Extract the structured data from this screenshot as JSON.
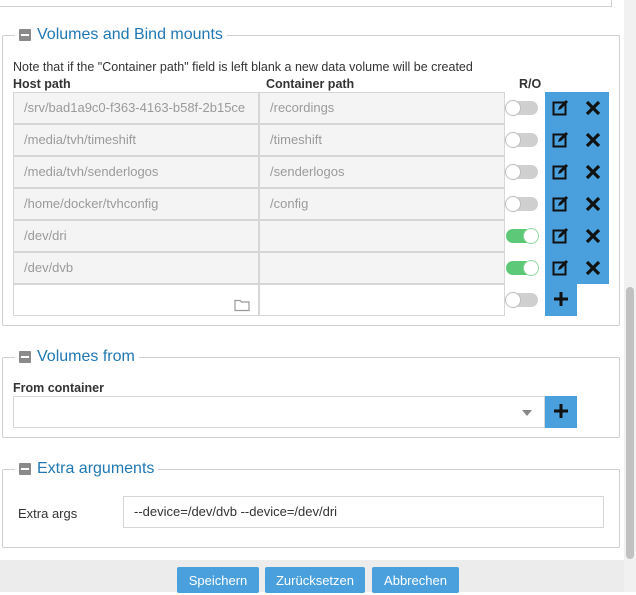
{
  "volumes": {
    "title": "Volumes and Bind mounts",
    "note": "Note that if the \"Container path\" field is left blank a new data volume will be created",
    "headers": {
      "host": "Host path",
      "container": "Container path",
      "ro": "R/O"
    },
    "rows": [
      {
        "host": "/srv/bad1a9c0-f363-4163-b58f-2b15ce",
        "container": "/recordings",
        "ro": false
      },
      {
        "host": "/media/tvh/timeshift",
        "container": "/timeshift",
        "ro": false
      },
      {
        "host": "/media/tvh/senderlogos",
        "container": "/senderlogos",
        "ro": false
      },
      {
        "host": "/home/docker/tvhconfig",
        "container": "/config",
        "ro": false
      },
      {
        "host": "/dev/dri",
        "container": "",
        "ro": true
      },
      {
        "host": "/dev/dvb",
        "container": "",
        "ro": true
      }
    ],
    "new_row": {
      "host": "",
      "container": "",
      "ro": false
    }
  },
  "volumes_from": {
    "title": "Volumes from",
    "label": "From container",
    "value": ""
  },
  "extra": {
    "title": "Extra arguments",
    "label": "Extra args",
    "value": "--device=/dev/dvb --device=/dev/dri"
  },
  "footer": {
    "save": "Speichern",
    "reset": "Zurücksetzen",
    "cancel": "Abbrechen"
  },
  "colors": {
    "accent": "#4aa0dd",
    "title": "#1f78b4",
    "toggle_on": "#5cc878"
  },
  "icons": {
    "edit": "edit-icon",
    "delete": "close-icon",
    "add": "plus-icon",
    "folder": "folder-icon"
  }
}
